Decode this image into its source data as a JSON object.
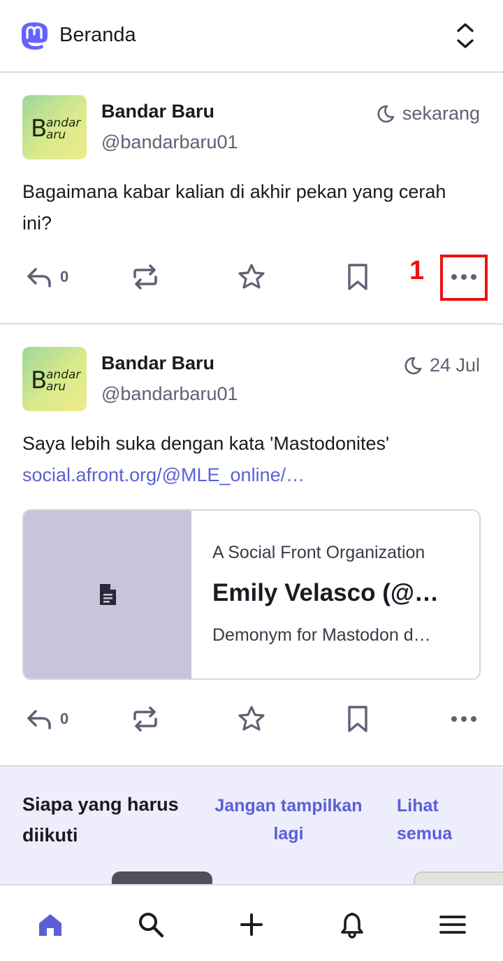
{
  "header": {
    "title": "Beranda",
    "logo_icon": "mastodon-logo",
    "collapse_icon": "chevron-up-down-icon"
  },
  "posts": [
    {
      "display_name": "Bandar Baru",
      "handle": "@bandarbaru01",
      "timestamp": "sekarang",
      "content": "Bagaimana kabar kalian di akhir pekan yang cerah ini?",
      "reply_count": "0",
      "avatar": {
        "big": "B",
        "top": "andar",
        "bottom": "aru"
      }
    },
    {
      "display_name": "Bandar Baru",
      "handle": "@bandarbaru01",
      "timestamp": "24 Jul",
      "content": "Saya lebih suka dengan kata 'Mastodonites'",
      "link_text": "social.afront.org/@MLE_online/…",
      "reply_count": "0",
      "avatar": {
        "big": "B",
        "top": "andar",
        "bottom": "aru"
      },
      "card": {
        "provider": "A Social Front Organization",
        "title": "Emily Velasco (@…",
        "description": "Demonym for Mastodon d…",
        "thumb_icon": "document-icon"
      }
    }
  ],
  "annotation": {
    "label": "1",
    "color": "#ee1111"
  },
  "suggestions": {
    "title": "Siapa yang harus diikuti",
    "dismiss_label": "Jangan tampilkan lagi",
    "view_all_label": "Lihat semua"
  },
  "nav": {
    "items": [
      "home-icon",
      "search-icon",
      "compose-icon",
      "notifications-icon",
      "menu-icon"
    ],
    "active_color": "#5b5fd4"
  },
  "colors": {
    "accent": "#5b5fd4",
    "secondary_text": "#606075",
    "icon": "#606075"
  }
}
